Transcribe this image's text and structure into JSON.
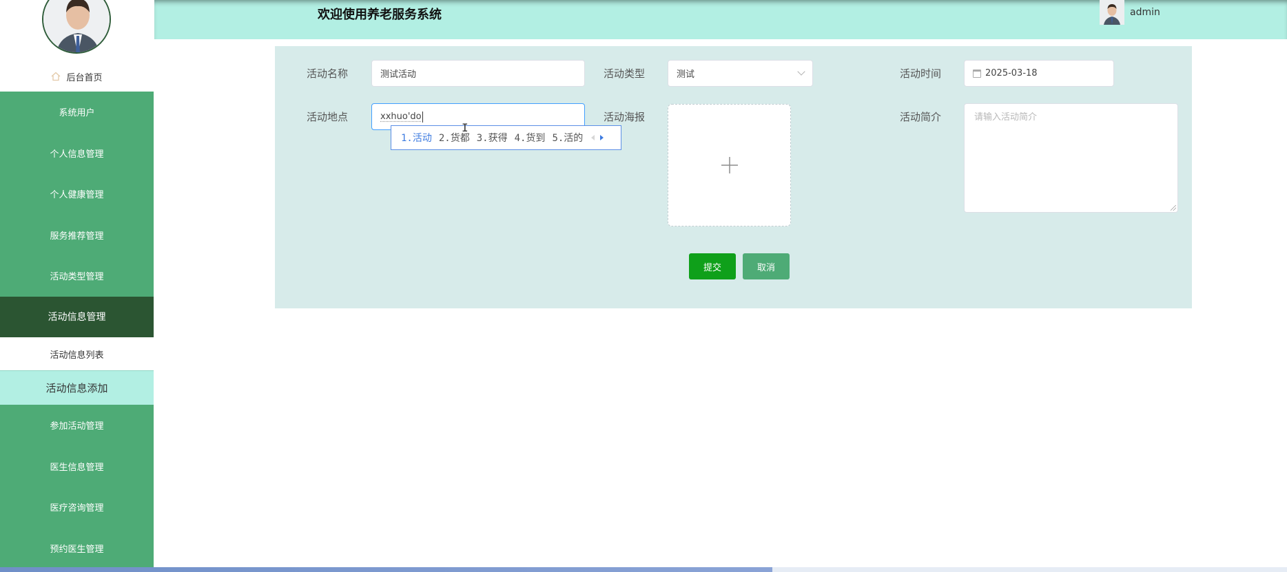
{
  "header": {
    "title": "欢迎使用养老服务系统",
    "username": "admin"
  },
  "sidebar": {
    "home_label": "后台首页",
    "items": [
      {
        "label": "系统用户"
      },
      {
        "label": "个人信息管理"
      },
      {
        "label": "个人健康管理"
      },
      {
        "label": "服务推荐管理"
      },
      {
        "label": "活动类型管理"
      },
      {
        "label": "活动信息管理",
        "active": true
      },
      {
        "label": "活动信息列表",
        "sub": true
      },
      {
        "label": "活动信息添加",
        "sub": true,
        "selected": true
      },
      {
        "label": "参加活动管理"
      },
      {
        "label": "医生信息管理"
      },
      {
        "label": "医疗咨询管理"
      },
      {
        "label": "预约医生管理"
      }
    ]
  },
  "form": {
    "name_label": "活动名称",
    "name_value": "测试活动",
    "type_label": "活动类型",
    "type_value": "测试",
    "time_label": "活动时间",
    "time_value": "2025-03-18",
    "location_label": "活动地点",
    "location_value": "xxhuo'do",
    "poster_label": "活动海报",
    "poster_icon": "plus-icon",
    "intro_label": "活动简介",
    "intro_placeholder": "请输入活动简介",
    "submit_label": "提交",
    "cancel_label": "取消"
  },
  "ime": {
    "candidates": [
      "1.活动",
      "2.货都",
      "3.获得",
      "4.货到",
      "5.活的"
    ]
  },
  "colors": {
    "sidebar_green": "#4eab76",
    "sidebar_active": "#2b5532",
    "header_bg": "#b2efe3",
    "panel_bg": "#d7ebea",
    "submit_green": "#0fa01a",
    "ime_blue": "#3d7be0"
  }
}
